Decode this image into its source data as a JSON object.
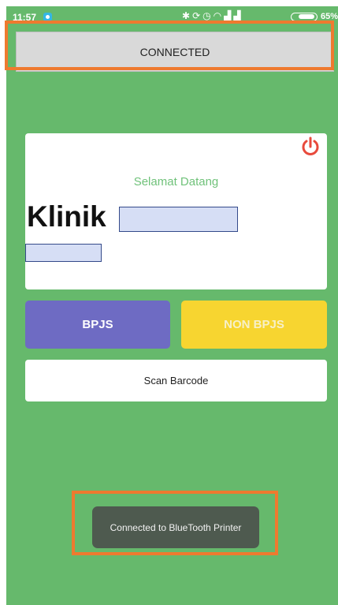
{
  "status_bar": {
    "time": "11:57",
    "icons": [
      "bluetooth-icon",
      "rotate-icon",
      "alarm-icon",
      "wifi-icon",
      "signal-icon",
      "signal-icon",
      "battery-icon"
    ],
    "battery_level": "65%"
  },
  "connection": {
    "status_label": "CONNECTED"
  },
  "welcome": {
    "greeting": "Selamat Datang",
    "clinic_name": "Klinik"
  },
  "actions": {
    "bpjs_label": "BPJS",
    "non_bpjs_label": "NON BPJS",
    "scan_label": "Scan Barcode"
  },
  "toast": {
    "message": "Connected to BlueTooth Printer"
  },
  "colors": {
    "background": "#66b96c",
    "bpjs_button": "#6e6bc3",
    "non_bpjs_button": "#f7d530",
    "power_icon": "#e84a3c",
    "highlight": "#ee7a2f",
    "toast": "#4e5a4f"
  }
}
